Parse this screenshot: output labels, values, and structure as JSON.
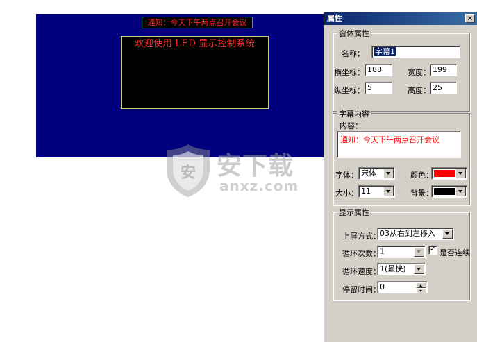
{
  "led": {
    "notice_text": "通知：今天下午两点召开会议",
    "welcome_text": "欢迎使用 LED 显示控制系统"
  },
  "watermark": {
    "text_cn": "安下载",
    "text_en": "anxz.com"
  },
  "properties": {
    "title": "属性",
    "window_group": {
      "legend": "窗体属性",
      "name_label": "名称：",
      "name_value": "字幕1",
      "x_label": "横坐标：",
      "x_value": "188",
      "width_label": "宽度：",
      "width_value": "199",
      "y_label": "纵坐标：",
      "y_value": "5",
      "height_label": "高度：",
      "height_value": "25"
    },
    "content_group": {
      "legend": "字幕内容",
      "content_label": "内容：",
      "content_value": "通知：今天下午两点召开会议",
      "font_label": "字体：",
      "font_value": "宋体",
      "color_label": "颜色：",
      "color_value": "#ff0000",
      "size_label": "大小：",
      "size_value": "11",
      "bg_label": "背景：",
      "bg_value": "#000000"
    },
    "display_group": {
      "legend": "显示属性",
      "screen_mode_label": "上屏方式：",
      "screen_mode_value": "03从右到左移入",
      "loop_count_label": "循环次数：",
      "loop_count_value": "1",
      "continuous_label": "是否连续",
      "continuous_checked": true,
      "loop_speed_label": "循环速度：",
      "loop_speed_value": "1(最快)",
      "dwell_label": "停留时间：",
      "dwell_value": "0"
    }
  },
  "colors": {
    "canvas": "#00007f",
    "led_text": "#ff2a2a",
    "titlebar": "#08246b",
    "dialog": "#d4d0c8"
  }
}
